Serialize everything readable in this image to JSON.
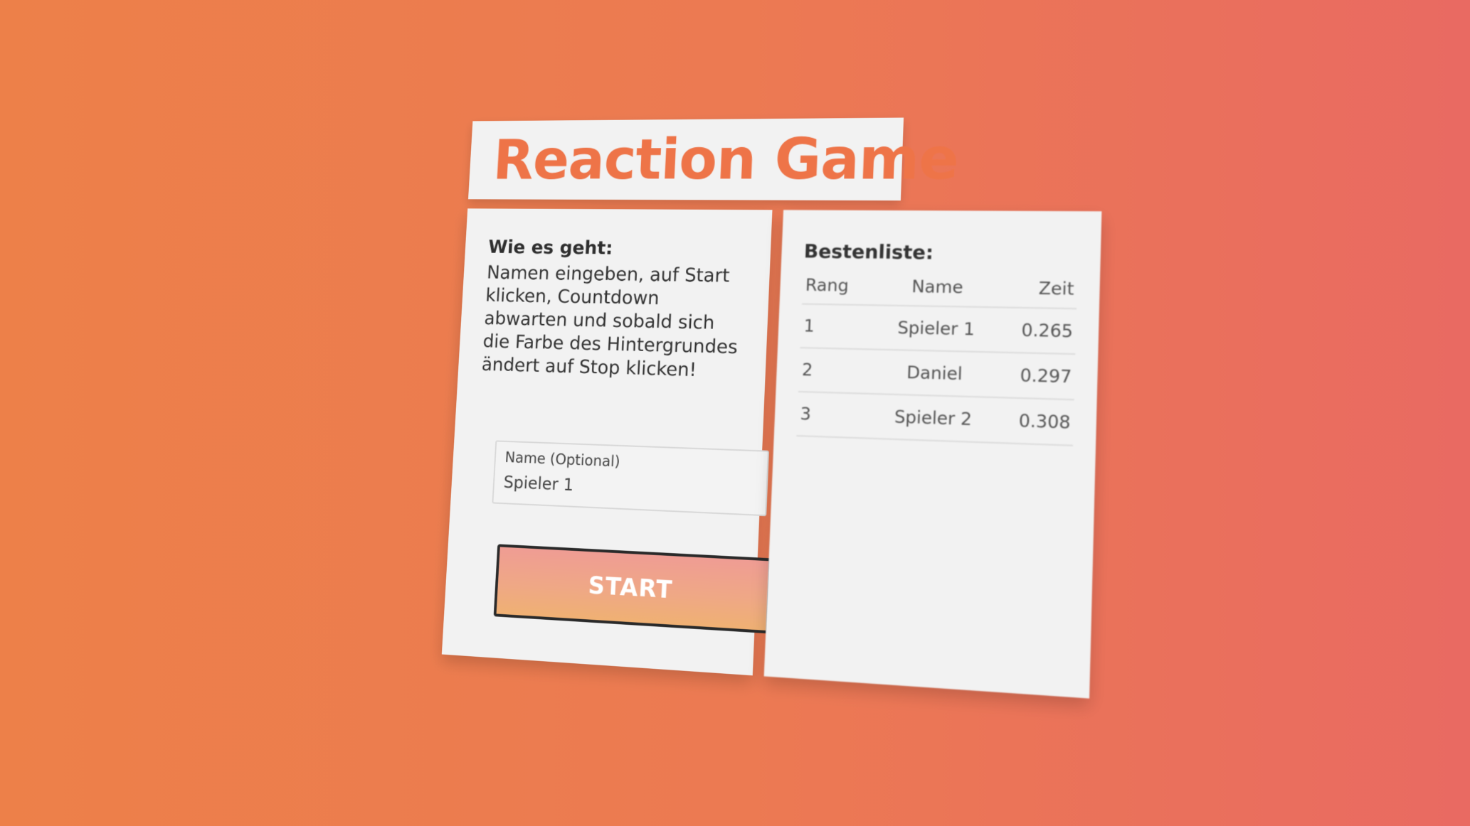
{
  "app": {
    "title": "Reaction Game"
  },
  "instructions": {
    "heading": "Wie es geht:",
    "text": "Namen eingeben, auf Start klicken, Countdown abwarten und sobald sich die Farbe des Hintergrundes ändert auf Stop klicken!"
  },
  "name_field": {
    "label": "Name (Optional)",
    "value": "Spieler 1"
  },
  "start_button": {
    "label": "START"
  },
  "leaderboard": {
    "title": "Bestenliste:",
    "columns": {
      "rank": "Rang",
      "name": "Name",
      "time": "Zeit"
    },
    "rows": [
      {
        "rank": "1",
        "name": "Spieler 1",
        "time": "0.265"
      },
      {
        "rank": "2",
        "name": "Daniel",
        "time": "0.297"
      },
      {
        "rank": "3",
        "name": "Spieler 2",
        "time": "0.308"
      }
    ]
  },
  "colors": {
    "background_start": "#ED8049",
    "background_end": "#E96A62",
    "accent": "#EE7448",
    "card": "#F2F2F2"
  }
}
